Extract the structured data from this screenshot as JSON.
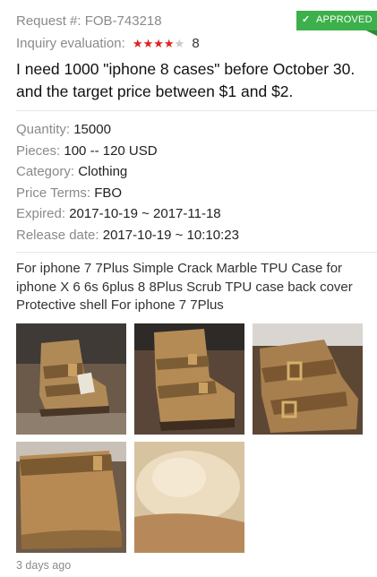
{
  "request": {
    "label": "Request #:",
    "number": "FOB-743218"
  },
  "status": {
    "label": "APPROVED",
    "color": "#3cb04a",
    "icon": "check-icon"
  },
  "evaluation": {
    "label": "Inquiry evaluation:",
    "stars_filled": 4,
    "stars_total": 5,
    "value": "8"
  },
  "message": "I need 1000 \"iphone 8 cases\" before October 30. and the target price between $1 and $2.",
  "details": [
    {
      "key": "Quantity:",
      "value": "15000"
    },
    {
      "key": "Pieces:",
      "value": "100 -- 120 USD"
    },
    {
      "key": "Category:",
      "value": "Clothing"
    },
    {
      "key": "Price Terms:",
      "value": "FBO"
    },
    {
      "key": "Expired:",
      "value": "2017-10-19 ~ 2017-11-18"
    },
    {
      "key": "Release date:",
      "value": "2017-10-19 ~ 10:10:23"
    }
  ],
  "product_title": "For iphone 7 7Plus Simple Crack Marble TPU Case for iphone X 6 6s 6plus 8 8Plus Scrub TPU case back cover Protective shell For iphone 7 7Plus",
  "images": [
    {
      "name": "boot-photo-1",
      "subject": "suede-ankle-boot-with-tag"
    },
    {
      "name": "boot-photo-2",
      "subject": "suede-boot-side-buckles"
    },
    {
      "name": "boot-photo-3",
      "subject": "suede-boot-buckle-closeup"
    },
    {
      "name": "boot-photo-4",
      "subject": "suede-boot-toe-closeup"
    },
    {
      "name": "boot-photo-5",
      "subject": "boot-fur-lining-closeup"
    }
  ],
  "posted_ago": "3 days ago",
  "colors": {
    "star_on": "#e02020",
    "star_off": "#c8c8c8",
    "label_gray": "#8a8a8a"
  }
}
